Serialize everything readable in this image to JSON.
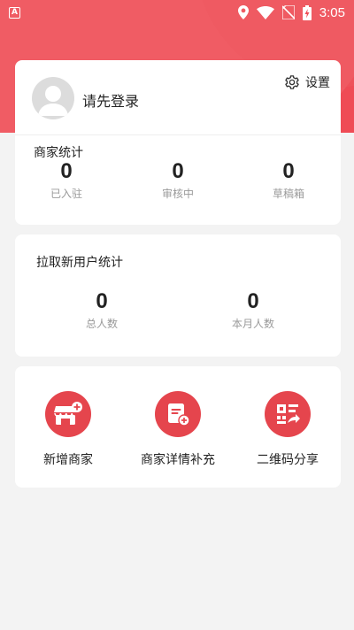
{
  "status_bar": {
    "app_icon_letter": "A",
    "time": "3:05"
  },
  "profile": {
    "login_prompt": "请先登录",
    "settings_label": "设置"
  },
  "merchant_stats": {
    "title": "商家统计",
    "items": [
      {
        "value": "0",
        "label": "已入驻"
      },
      {
        "value": "0",
        "label": "审核中"
      },
      {
        "value": "0",
        "label": "草稿箱"
      }
    ]
  },
  "user_stats": {
    "title": "拉取新用户统计",
    "items": [
      {
        "value": "0",
        "label": "总人数"
      },
      {
        "value": "0",
        "label": "本月人数"
      }
    ]
  },
  "actions": [
    {
      "label": "新增商家",
      "icon": "store-add-icon"
    },
    {
      "label": "商家详情补充",
      "icon": "document-add-icon"
    },
    {
      "label": "二维码分享",
      "icon": "qr-share-icon"
    }
  ],
  "colors": {
    "brand_red": "#ef4b55",
    "action_red": "#e5454d",
    "background": "#f3f3f3"
  }
}
